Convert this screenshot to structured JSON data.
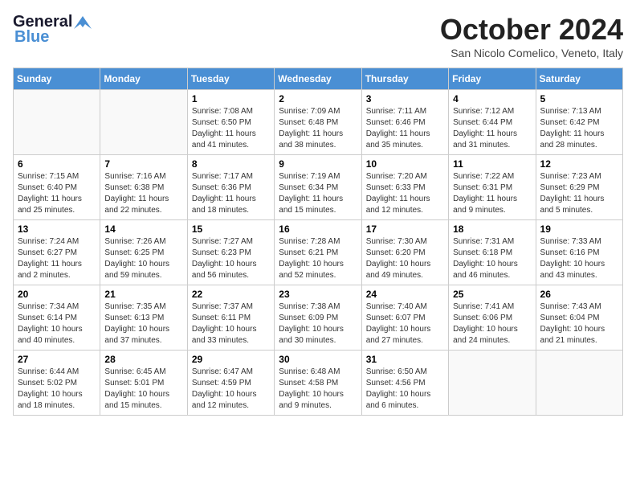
{
  "header": {
    "logo_line1": "General",
    "logo_line2": "Blue",
    "month_title": "October 2024",
    "location": "San Nicolo Comelico, Veneto, Italy"
  },
  "weekdays": [
    "Sunday",
    "Monday",
    "Tuesday",
    "Wednesday",
    "Thursday",
    "Friday",
    "Saturday"
  ],
  "weeks": [
    [
      {
        "day": "",
        "sunrise": "",
        "sunset": "",
        "daylight": ""
      },
      {
        "day": "",
        "sunrise": "",
        "sunset": "",
        "daylight": ""
      },
      {
        "day": "1",
        "sunrise": "Sunrise: 7:08 AM",
        "sunset": "Sunset: 6:50 PM",
        "daylight": "Daylight: 11 hours and 41 minutes."
      },
      {
        "day": "2",
        "sunrise": "Sunrise: 7:09 AM",
        "sunset": "Sunset: 6:48 PM",
        "daylight": "Daylight: 11 hours and 38 minutes."
      },
      {
        "day": "3",
        "sunrise": "Sunrise: 7:11 AM",
        "sunset": "Sunset: 6:46 PM",
        "daylight": "Daylight: 11 hours and 35 minutes."
      },
      {
        "day": "4",
        "sunrise": "Sunrise: 7:12 AM",
        "sunset": "Sunset: 6:44 PM",
        "daylight": "Daylight: 11 hours and 31 minutes."
      },
      {
        "day": "5",
        "sunrise": "Sunrise: 7:13 AM",
        "sunset": "Sunset: 6:42 PM",
        "daylight": "Daylight: 11 hours and 28 minutes."
      }
    ],
    [
      {
        "day": "6",
        "sunrise": "Sunrise: 7:15 AM",
        "sunset": "Sunset: 6:40 PM",
        "daylight": "Daylight: 11 hours and 25 minutes."
      },
      {
        "day": "7",
        "sunrise": "Sunrise: 7:16 AM",
        "sunset": "Sunset: 6:38 PM",
        "daylight": "Daylight: 11 hours and 22 minutes."
      },
      {
        "day": "8",
        "sunrise": "Sunrise: 7:17 AM",
        "sunset": "Sunset: 6:36 PM",
        "daylight": "Daylight: 11 hours and 18 minutes."
      },
      {
        "day": "9",
        "sunrise": "Sunrise: 7:19 AM",
        "sunset": "Sunset: 6:34 PM",
        "daylight": "Daylight: 11 hours and 15 minutes."
      },
      {
        "day": "10",
        "sunrise": "Sunrise: 7:20 AM",
        "sunset": "Sunset: 6:33 PM",
        "daylight": "Daylight: 11 hours and 12 minutes."
      },
      {
        "day": "11",
        "sunrise": "Sunrise: 7:22 AM",
        "sunset": "Sunset: 6:31 PM",
        "daylight": "Daylight: 11 hours and 9 minutes."
      },
      {
        "day": "12",
        "sunrise": "Sunrise: 7:23 AM",
        "sunset": "Sunset: 6:29 PM",
        "daylight": "Daylight: 11 hours and 5 minutes."
      }
    ],
    [
      {
        "day": "13",
        "sunrise": "Sunrise: 7:24 AM",
        "sunset": "Sunset: 6:27 PM",
        "daylight": "Daylight: 11 hours and 2 minutes."
      },
      {
        "day": "14",
        "sunrise": "Sunrise: 7:26 AM",
        "sunset": "Sunset: 6:25 PM",
        "daylight": "Daylight: 10 hours and 59 minutes."
      },
      {
        "day": "15",
        "sunrise": "Sunrise: 7:27 AM",
        "sunset": "Sunset: 6:23 PM",
        "daylight": "Daylight: 10 hours and 56 minutes."
      },
      {
        "day": "16",
        "sunrise": "Sunrise: 7:28 AM",
        "sunset": "Sunset: 6:21 PM",
        "daylight": "Daylight: 10 hours and 52 minutes."
      },
      {
        "day": "17",
        "sunrise": "Sunrise: 7:30 AM",
        "sunset": "Sunset: 6:20 PM",
        "daylight": "Daylight: 10 hours and 49 minutes."
      },
      {
        "day": "18",
        "sunrise": "Sunrise: 7:31 AM",
        "sunset": "Sunset: 6:18 PM",
        "daylight": "Daylight: 10 hours and 46 minutes."
      },
      {
        "day": "19",
        "sunrise": "Sunrise: 7:33 AM",
        "sunset": "Sunset: 6:16 PM",
        "daylight": "Daylight: 10 hours and 43 minutes."
      }
    ],
    [
      {
        "day": "20",
        "sunrise": "Sunrise: 7:34 AM",
        "sunset": "Sunset: 6:14 PM",
        "daylight": "Daylight: 10 hours and 40 minutes."
      },
      {
        "day": "21",
        "sunrise": "Sunrise: 7:35 AM",
        "sunset": "Sunset: 6:13 PM",
        "daylight": "Daylight: 10 hours and 37 minutes."
      },
      {
        "day": "22",
        "sunrise": "Sunrise: 7:37 AM",
        "sunset": "Sunset: 6:11 PM",
        "daylight": "Daylight: 10 hours and 33 minutes."
      },
      {
        "day": "23",
        "sunrise": "Sunrise: 7:38 AM",
        "sunset": "Sunset: 6:09 PM",
        "daylight": "Daylight: 10 hours and 30 minutes."
      },
      {
        "day": "24",
        "sunrise": "Sunrise: 7:40 AM",
        "sunset": "Sunset: 6:07 PM",
        "daylight": "Daylight: 10 hours and 27 minutes."
      },
      {
        "day": "25",
        "sunrise": "Sunrise: 7:41 AM",
        "sunset": "Sunset: 6:06 PM",
        "daylight": "Daylight: 10 hours and 24 minutes."
      },
      {
        "day": "26",
        "sunrise": "Sunrise: 7:43 AM",
        "sunset": "Sunset: 6:04 PM",
        "daylight": "Daylight: 10 hours and 21 minutes."
      }
    ],
    [
      {
        "day": "27",
        "sunrise": "Sunrise: 6:44 AM",
        "sunset": "Sunset: 5:02 PM",
        "daylight": "Daylight: 10 hours and 18 minutes."
      },
      {
        "day": "28",
        "sunrise": "Sunrise: 6:45 AM",
        "sunset": "Sunset: 5:01 PM",
        "daylight": "Daylight: 10 hours and 15 minutes."
      },
      {
        "day": "29",
        "sunrise": "Sunrise: 6:47 AM",
        "sunset": "Sunset: 4:59 PM",
        "daylight": "Daylight: 10 hours and 12 minutes."
      },
      {
        "day": "30",
        "sunrise": "Sunrise: 6:48 AM",
        "sunset": "Sunset: 4:58 PM",
        "daylight": "Daylight: 10 hours and 9 minutes."
      },
      {
        "day": "31",
        "sunrise": "Sunrise: 6:50 AM",
        "sunset": "Sunset: 4:56 PM",
        "daylight": "Daylight: 10 hours and 6 minutes."
      },
      {
        "day": "",
        "sunrise": "",
        "sunset": "",
        "daylight": ""
      },
      {
        "day": "",
        "sunrise": "",
        "sunset": "",
        "daylight": ""
      }
    ]
  ]
}
